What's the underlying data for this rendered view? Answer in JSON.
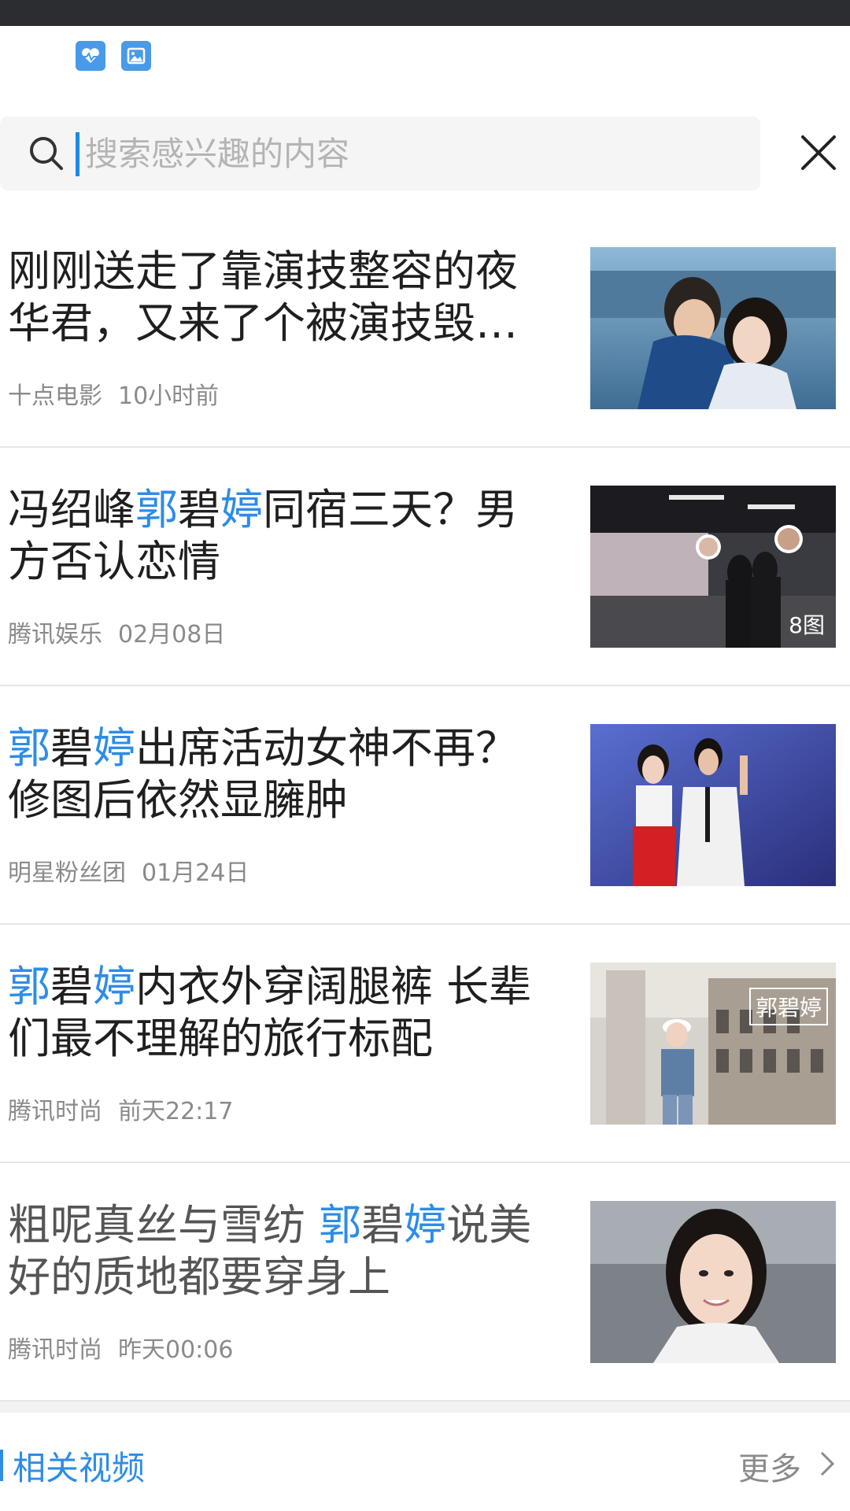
{
  "search": {
    "placeholder": "搜索感兴趣的内容"
  },
  "news": [
    {
      "title_parts": [
        {
          "text": "刚刚送走了靠演技整容的夜华君，又来了个被演技毁容的",
          "hl": false
        }
      ],
      "source": "十点电影",
      "time": "10小时前",
      "thumb_badge": ""
    },
    {
      "title_parts": [
        {
          "text": "冯绍峰",
          "hl": false
        },
        {
          "text": "郭",
          "hl": true
        },
        {
          "text": "碧",
          "hl": false
        },
        {
          "text": "婷",
          "hl": true
        },
        {
          "text": "同宿三天？男方否认恋情",
          "hl": false
        }
      ],
      "source": "腾讯娱乐",
      "time": "02月08日",
      "thumb_badge": "8图"
    },
    {
      "title_parts": [
        {
          "text": "郭",
          "hl": true
        },
        {
          "text": "碧",
          "hl": false
        },
        {
          "text": "婷",
          "hl": true
        },
        {
          "text": "出席活动女神不再？修图后依然显臃肿",
          "hl": false
        }
      ],
      "source": "明星粉丝团",
      "time": "01月24日",
      "thumb_badge": ""
    },
    {
      "title_parts": [
        {
          "text": "郭",
          "hl": true
        },
        {
          "text": "碧",
          "hl": false
        },
        {
          "text": "婷",
          "hl": true
        },
        {
          "text": "内衣外穿阔腿裤 长辈们最不理解的旅行标配",
          "hl": false
        }
      ],
      "source": "腾讯时尚",
      "time": "前天22:17",
      "thumb_watermark": "郭碧婷"
    },
    {
      "title_parts": [
        {
          "text": "粗呢真丝与雪纺 ",
          "hl": false
        },
        {
          "text": "郭",
          "hl": true
        },
        {
          "text": "碧",
          "hl": false
        },
        {
          "text": "婷",
          "hl": true
        },
        {
          "text": "说美好的质地都要穿身上",
          "hl": false
        }
      ],
      "source": "腾讯时尚",
      "time": "昨天00:06",
      "gray": true
    }
  ],
  "related": {
    "title": "相关视频",
    "more": "更多"
  },
  "colors": {
    "accent": "#2d8ce8",
    "status_bar": "#2b2d31"
  }
}
